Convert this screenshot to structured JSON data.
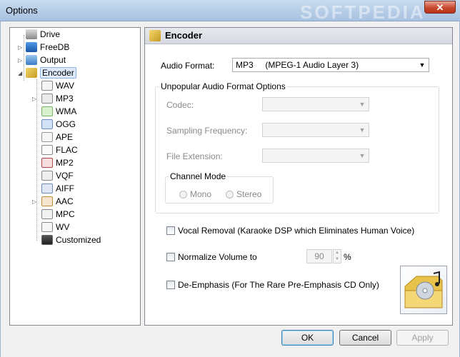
{
  "window": {
    "title": "Options",
    "close_glyph": "✕",
    "watermark": "SOFTPEDIA"
  },
  "tree": {
    "items": [
      {
        "label": "Drive",
        "icon": "drive-icon"
      },
      {
        "label": "FreeDB",
        "icon": "freedb-icon"
      },
      {
        "label": "Output",
        "icon": "output-icon"
      },
      {
        "label": "Encoder",
        "icon": "encoder-icon"
      },
      {
        "label": "WAV",
        "icon": "wav-icon"
      },
      {
        "label": "MP3",
        "icon": "mp3-icon"
      },
      {
        "label": "WMA",
        "icon": "wma-icon"
      },
      {
        "label": "OGG",
        "icon": "ogg-icon"
      },
      {
        "label": "APE",
        "icon": "ape-icon"
      },
      {
        "label": "FLAC",
        "icon": "flac-icon"
      },
      {
        "label": "MP2",
        "icon": "mp2-icon"
      },
      {
        "label": "VQF",
        "icon": "vqf-icon"
      },
      {
        "label": "AIFF",
        "icon": "aiff-icon"
      },
      {
        "label": "AAC",
        "icon": "aac-icon"
      },
      {
        "label": "MPC",
        "icon": "mpc-icon"
      },
      {
        "label": "WV",
        "icon": "wv-icon"
      },
      {
        "label": "Customized",
        "icon": "customized-icon"
      }
    ]
  },
  "encoder": {
    "header": "Encoder",
    "audio_format_label": "Audio Format:",
    "audio_format_value": "MP3     (MPEG-1 Audio Layer 3)",
    "unpopular_group": "Unpopular Audio Format Options",
    "codec_label": "Codec:",
    "sampling_label": "Sampling Frequency:",
    "extension_label": "File Extension:",
    "channel_group": "Channel Mode",
    "mono_label": "Mono",
    "stereo_label": "Stereo",
    "vocal_removal_label": "Vocal Removal (Karaoke DSP which Eliminates Human Voice)",
    "normalize_label": "Normalize Volume to",
    "normalize_value": "90",
    "normalize_unit": "%",
    "deemphasis_label": "De-Emphasis (For The Rare Pre-Emphasis CD Only)"
  },
  "buttons": {
    "ok": "OK",
    "cancel": "Cancel",
    "apply": "Apply"
  },
  "colors": {
    "selection": "#dceafc",
    "close_button": "#c8482e"
  }
}
